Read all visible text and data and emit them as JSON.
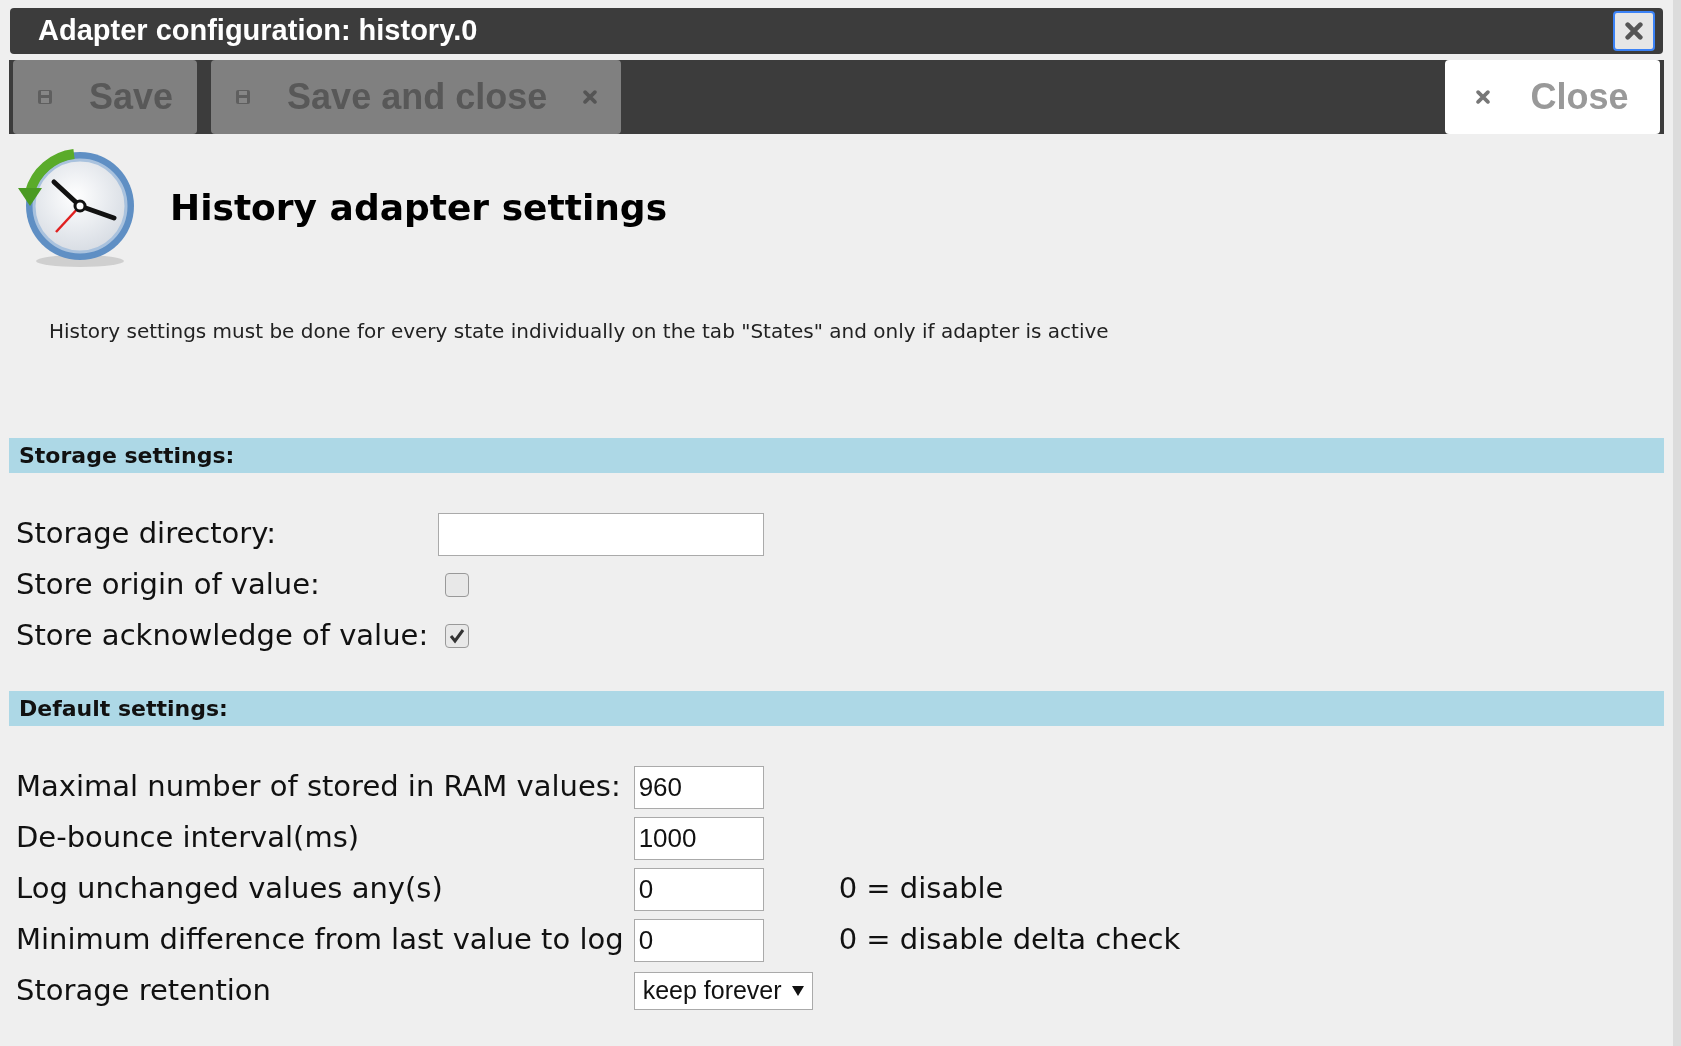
{
  "window": {
    "title": "Adapter configuration: history.0"
  },
  "toolbar": {
    "buttons": [
      {
        "label": "Save",
        "disabled": true,
        "kind": "save"
      },
      {
        "label": "Save and close",
        "disabled": true,
        "kind": "save-close"
      }
    ],
    "close": {
      "label": "Close"
    }
  },
  "header": {
    "title": "History adapter settings",
    "note": "History settings must be done for every state individually on the tab \"States\" and only if adapter is active"
  },
  "sections": [
    {
      "title": "Storage settings:",
      "fields": [
        {
          "kind": "text",
          "label": "Storage directory:"
        },
        {
          "kind": "checkbox",
          "label": "Store origin of value:",
          "checked": false
        },
        {
          "kind": "checkbox",
          "label": "Store acknowledge of value:",
          "checked": true
        }
      ]
    },
    {
      "title": "Default settings:",
      "fields": [
        {
          "kind": "number",
          "label": "Maximal number of stored in RAM values:",
          "value": "960"
        },
        {
          "kind": "number",
          "label": "De-bounce interval(ms)",
          "value": "1000"
        },
        {
          "kind": "number",
          "label": "Log unchanged values any(s)",
          "value": "0",
          "hint": "0 = disable"
        },
        {
          "kind": "number",
          "label": "Minimum difference from last value to log",
          "value": "0",
          "hint": "0 = disable delta check"
        },
        {
          "kind": "select",
          "label": "Storage retention",
          "value": "keep forever"
        }
      ]
    }
  ]
}
